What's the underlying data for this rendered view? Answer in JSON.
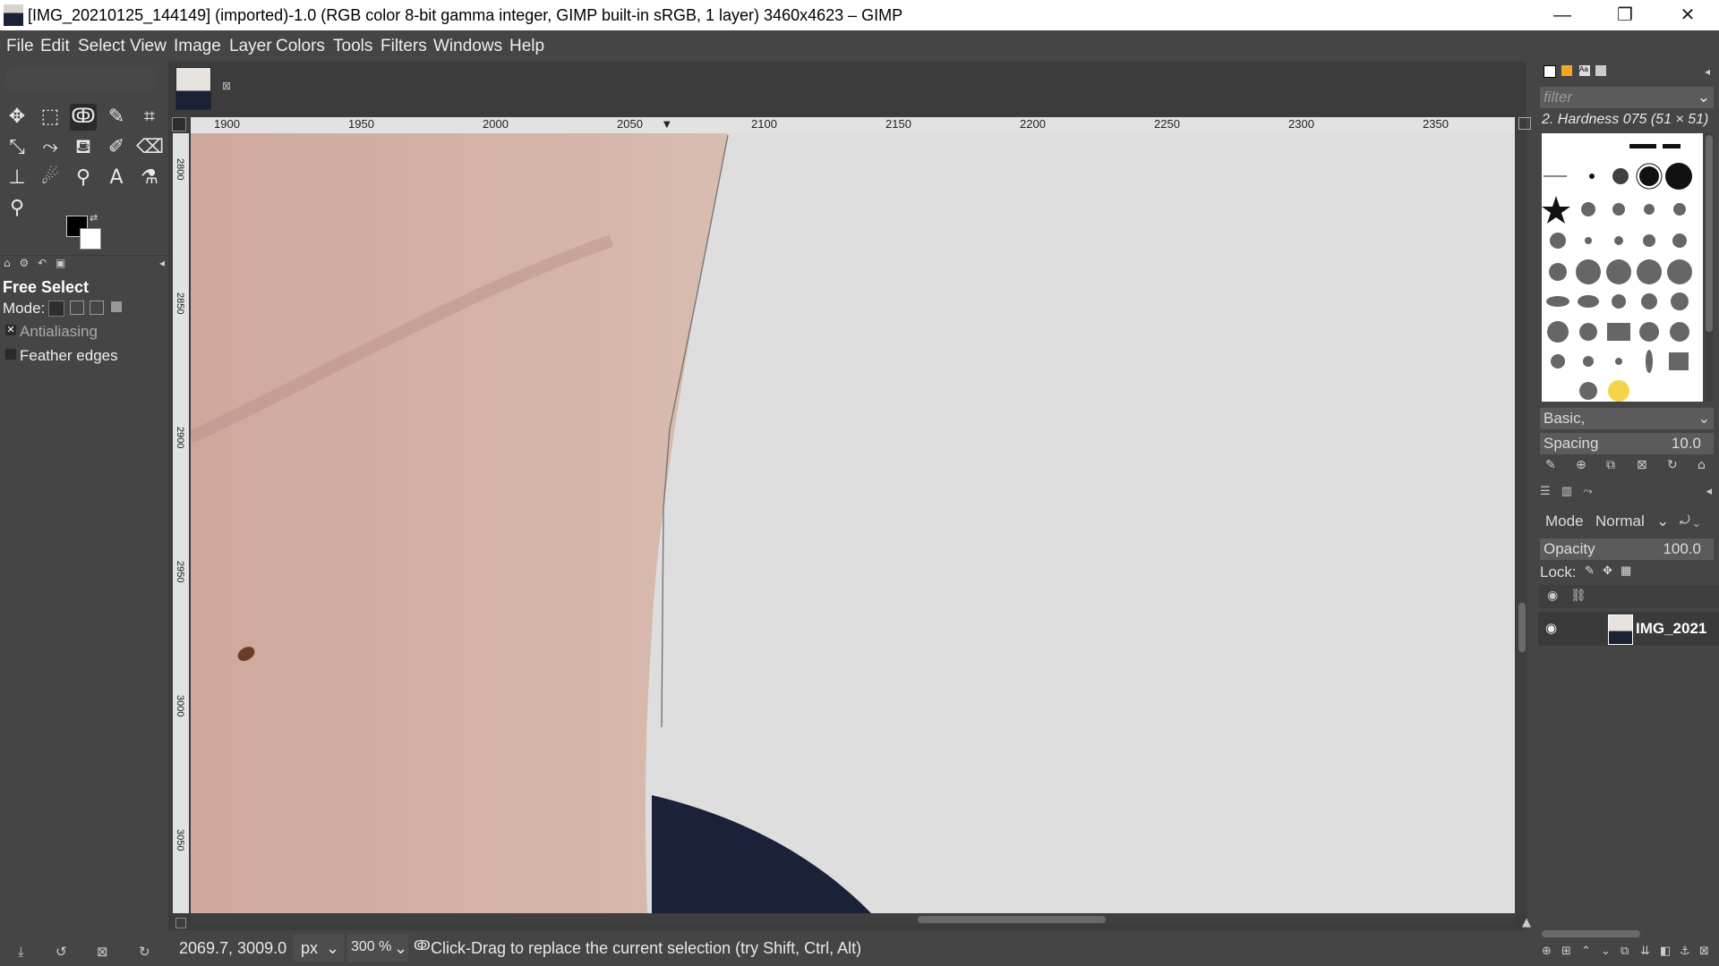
{
  "window": {
    "title": "[IMG_20210125_144149] (imported)-1.0 (RGB color 8-bit gamma integer, GIMP built-in sRGB, 1 layer) 3460x4623 – GIMP",
    "minimize_glyph": "—",
    "restore_glyph": "❐",
    "close_glyph": "✕"
  },
  "menu": [
    "File",
    "Edit",
    "Select",
    "View",
    "Image",
    "Layer",
    "Colors",
    "Tools",
    "Filters",
    "Windows",
    "Help"
  ],
  "toolbox": {
    "tools": [
      {
        "name": "move-tool-icon",
        "glyph": "✥"
      },
      {
        "name": "rect-select-icon",
        "glyph": "⬚"
      },
      {
        "name": "free-select-icon",
        "glyph": "ↂ"
      },
      {
        "name": "fuzzy-select-icon",
        "glyph": "✎"
      },
      {
        "name": "crop-icon",
        "glyph": "⌗"
      },
      {
        "name": "transform-icon",
        "glyph": "⤡"
      },
      {
        "name": "warp-icon",
        "glyph": "⤳"
      },
      {
        "name": "bucket-fill-icon",
        "glyph": "⛾"
      },
      {
        "name": "paintbrush-icon",
        "glyph": "✐"
      },
      {
        "name": "eraser-icon",
        "glyph": "⌫"
      },
      {
        "name": "clone-icon",
        "glyph": "⊥"
      },
      {
        "name": "smudge-icon",
        "glyph": "☄"
      },
      {
        "name": "paths-icon",
        "glyph": "⚲"
      },
      {
        "name": "text-tool-icon",
        "glyph": "A"
      },
      {
        "name": "color-picker-icon",
        "glyph": "⚗"
      },
      {
        "name": "zoom-icon",
        "glyph": "⚲"
      }
    ],
    "fg_color": "#000000",
    "bg_color": "#ffffff"
  },
  "tool_options": {
    "title": "Free Select",
    "mode_label": "Mode:",
    "antialiasing_label": "Antialiasing",
    "feather_label": "Feather edges"
  },
  "ruler": {
    "h_ticks": [
      "1900",
      "1950",
      "2000",
      "2050",
      "2100",
      "2150",
      "2200",
      "2250",
      "2300",
      "2350"
    ],
    "v_ticks": [
      "2800",
      "2850",
      "2900",
      "2950",
      "3000",
      "3050"
    ]
  },
  "status": {
    "coords": "2069.7, 3009.0",
    "unit": "px",
    "zoom": "300 %",
    "message": "Click-Drag to replace the current selection (try Shift, Ctrl, Alt)"
  },
  "brushes": {
    "filter_placeholder": "filter",
    "selected": "2. Hardness 075 (51 × 51)",
    "tag": "Basic,",
    "spacing_label": "Spacing",
    "spacing_value": "10.0"
  },
  "layers": {
    "mode_label": "Mode",
    "mode_value": "Normal",
    "opacity_label": "Opacity",
    "opacity_value": "100.0",
    "lock_label": "Lock:",
    "layer_name": "IMG_2021"
  },
  "colors": {
    "background": "#454545",
    "skin": "#d2b0a4",
    "canvas_bg": "#dedede",
    "shirt": "#1b2138"
  }
}
